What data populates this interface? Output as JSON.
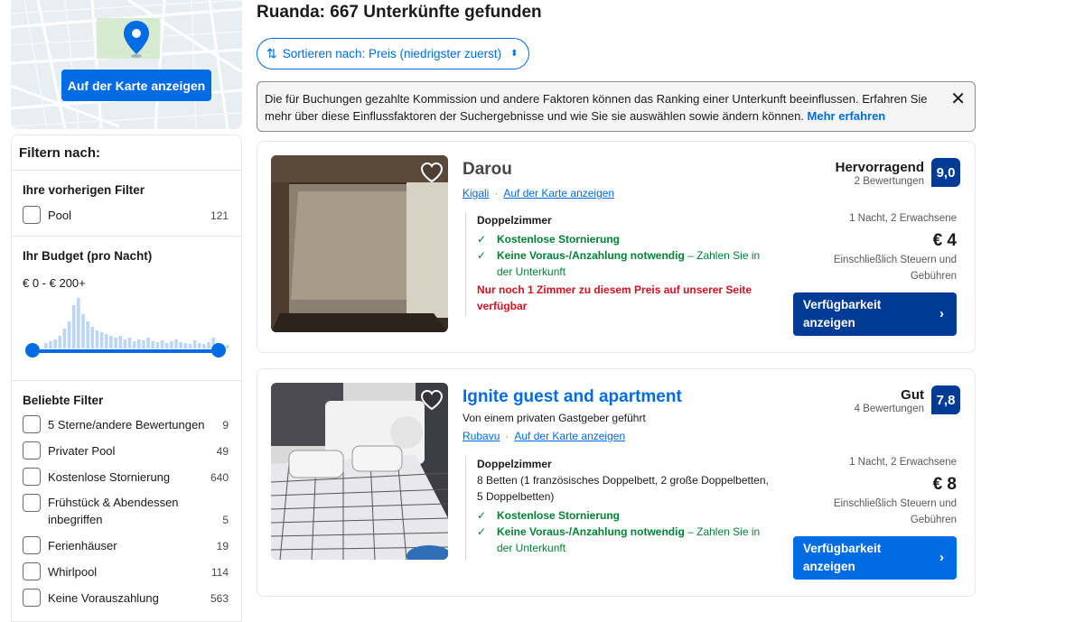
{
  "map": {
    "button_label": "Auf der Karte anzeigen"
  },
  "filters": {
    "title": "Filtern nach:",
    "previous": {
      "heading": "Ihre vorherigen Filter",
      "items": [
        {
          "label": "Pool",
          "count": "121"
        }
      ]
    },
    "budget": {
      "heading": "Ihr Budget (pro Nacht)",
      "range": "€ 0 - € 200+"
    },
    "popular": {
      "heading": "Beliebte Filter",
      "items": [
        {
          "label": "5 Sterne/andere Bewertungen",
          "count": "9"
        },
        {
          "label": "Privater Pool",
          "count": "49"
        },
        {
          "label": "Kostenlose Stornierung",
          "count": "640"
        },
        {
          "label": "Frühstück & Abendessen inbegriffen",
          "count": "5"
        },
        {
          "label": "Ferienhäuser",
          "count": "19"
        },
        {
          "label": "Whirlpool",
          "count": "114"
        },
        {
          "label": "Keine Vorauszahlung",
          "count": "563"
        }
      ]
    }
  },
  "results": {
    "title": "Ruanda: 667 Unterkünfte gefunden",
    "sort_label": "Sortieren nach: Preis (niedrigster zuerst)",
    "notice": {
      "text": "Die für Buchungen gezahlte Kommission und andere Faktoren können das Ranking einer Unterkunft beeinflussen. Erfahren Sie mehr über diese Einflussfaktoren der Suchergebnisse und wie Sie sie auswählen sowie ändern können.",
      "link": "Mehr erfahren"
    },
    "properties": [
      {
        "name": "Darou",
        "host": "",
        "city": "Kigali",
        "map_link": "Auf der Karte anzeigen",
        "room_type": "Doppelzimmer",
        "beds": "",
        "feature_1": "Kostenlose Stornierung",
        "feature_2": "Keine Voraus-/Anzahlung notwendig",
        "feature_2_rest": " – Zahlen Sie in der Unterkunft",
        "scarcity": "Nur noch 1 Zimmer zu diesem Preis auf unserer Seite verfügbar",
        "rating_word": "Hervorragend",
        "reviews": "2 Bewertungen",
        "score": "9,0",
        "stay": "1 Nacht, 2 Erwachsene",
        "price": "€ 4",
        "tax_note": "Einschließlich Steuern und Gebühren",
        "cta": "Verfügbarkeit anzeigen"
      },
      {
        "name": "Ignite guest and apartment",
        "host": "Von einem privaten Gastgeber geführt",
        "city": "Rubavu",
        "map_link": "Auf der Karte anzeigen",
        "room_type": "Doppelzimmer",
        "beds": "8 Betten (1 französisches Doppelbett, 2 große Doppelbetten, 5 Doppelbetten)",
        "feature_1": "Kostenlose Stornierung",
        "feature_2": "Keine Voraus-/Anzahlung notwendig",
        "feature_2_rest": " – Zahlen Sie in der Unterkunft",
        "scarcity": "",
        "rating_word": "Gut",
        "reviews": "4 Bewertungen",
        "score": "7,8",
        "stay": "1 Nacht, 2 Erwachsene",
        "price": "€ 8",
        "tax_note": "Einschließlich Steuern und Gebühren",
        "cta": "Verfügbarkeit anzeigen"
      }
    ]
  },
  "colors": {
    "primary": "#006ce4",
    "dark_blue": "#003b95",
    "success": "#008234",
    "danger": "#d4111e"
  },
  "icons": [
    "map-pin-icon",
    "sort-icon",
    "chevron-updown-icon",
    "close-icon",
    "heart-icon",
    "check-icon",
    "chevron-right-icon"
  ]
}
